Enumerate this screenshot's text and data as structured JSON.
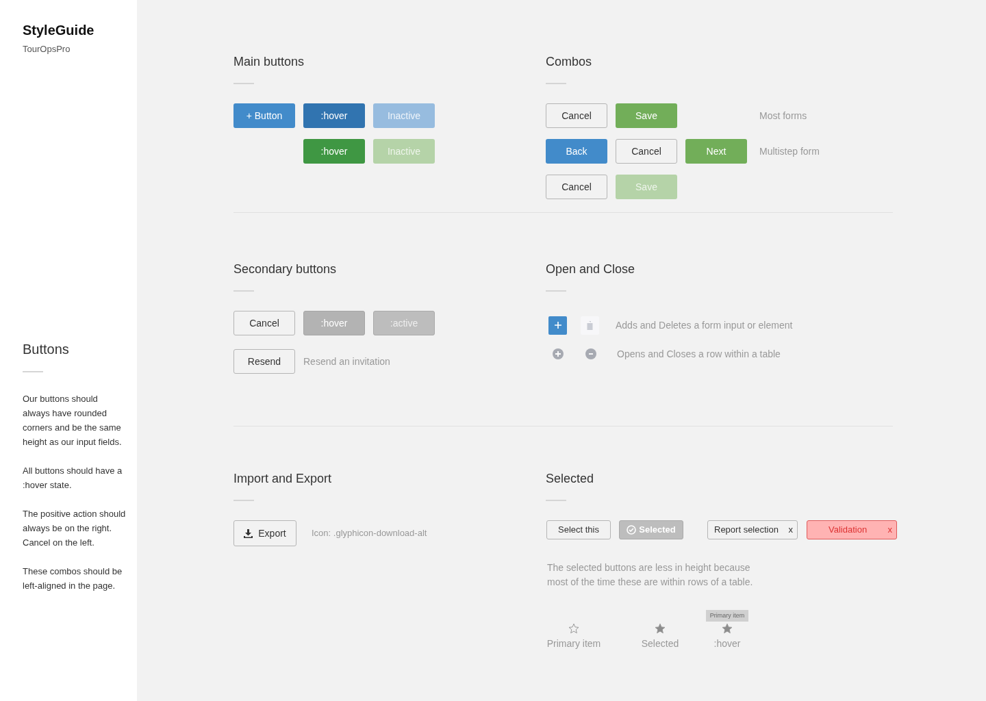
{
  "sidebar": {
    "brand": "StyleGuide",
    "subtitle": "TourOpsPro",
    "section_title": "Buttons",
    "paragraphs": [
      "Our buttons should always have rounded corners and be the same height as our input fields.",
      "All buttons should have a :hover state.",
      "The positive action should always be on the right. Cancel on the left.",
      "These combos should be left-aligned in the page."
    ]
  },
  "main_buttons": {
    "title": "Main buttons",
    "rows": [
      [
        {
          "label": "+ Button",
          "kind": "primary"
        },
        {
          "label": ":hover",
          "kind": "primary-hover"
        },
        {
          "label": "Inactive",
          "kind": "primary-inactive"
        }
      ],
      [
        "",
        {
          "label": ":hover",
          "kind": "green-hover"
        },
        {
          "label": "Inactive",
          "kind": "green-inactive"
        }
      ]
    ]
  },
  "combos": {
    "title": "Combos",
    "rows": [
      {
        "buttons": [
          {
            "label": "Cancel",
            "kind": "secondary"
          },
          {
            "label": "Save",
            "kind": "green"
          }
        ],
        "note": "Most forms"
      },
      {
        "buttons": [
          {
            "label": "Back",
            "kind": "primary"
          },
          {
            "label": "Cancel",
            "kind": "secondary"
          },
          {
            "label": "Next",
            "kind": "green"
          }
        ],
        "note": "Multistep form"
      },
      {
        "buttons": [
          {
            "label": "Cancel",
            "kind": "secondary"
          },
          {
            "label": "Save",
            "kind": "green-inactive"
          }
        ]
      }
    ]
  },
  "secondary_buttons": {
    "title": "Secondary buttons",
    "rows": [
      {
        "buttons": [
          {
            "label": "Cancel",
            "kind": "secondary"
          },
          {
            "label": ":hover",
            "kind": "secondary-hover"
          },
          {
            "label": ":active",
            "kind": "secondary-active"
          }
        ]
      },
      {
        "buttons": [
          {
            "label": "Resend",
            "kind": "secondary"
          }
        ],
        "note": "Resend an invitation"
      }
    ]
  },
  "open_close": {
    "title": "Open and Close",
    "rows": [
      {
        "kind": "square",
        "text": "Adds and Deletes a form input or element"
      },
      {
        "kind": "circle",
        "text": "Opens and Closes a row within a table"
      }
    ]
  },
  "import_export": {
    "title": "Import and Export",
    "button": "Export",
    "note": "Icon: .glyphicon-download-alt"
  },
  "selected": {
    "title": "Selected",
    "buttons": [
      {
        "label": "Select this",
        "kind": "toggle",
        "selected": false
      },
      {
        "label": "Selected",
        "kind": "toggle",
        "selected": true
      },
      {
        "label": "Report selection",
        "kind": "removable",
        "close": "x"
      },
      {
        "label": "Validation",
        "kind": "error",
        "close": "x"
      }
    ],
    "description": "The selected buttons are less in height because most of the time these are within rows of a table.",
    "stars": [
      {
        "label": "Primary item",
        "filled": false
      },
      {
        "label": "Selected",
        "filled": true
      },
      {
        "label": ":hover",
        "filled": true,
        "tooltip": "Primary item"
      }
    ]
  }
}
